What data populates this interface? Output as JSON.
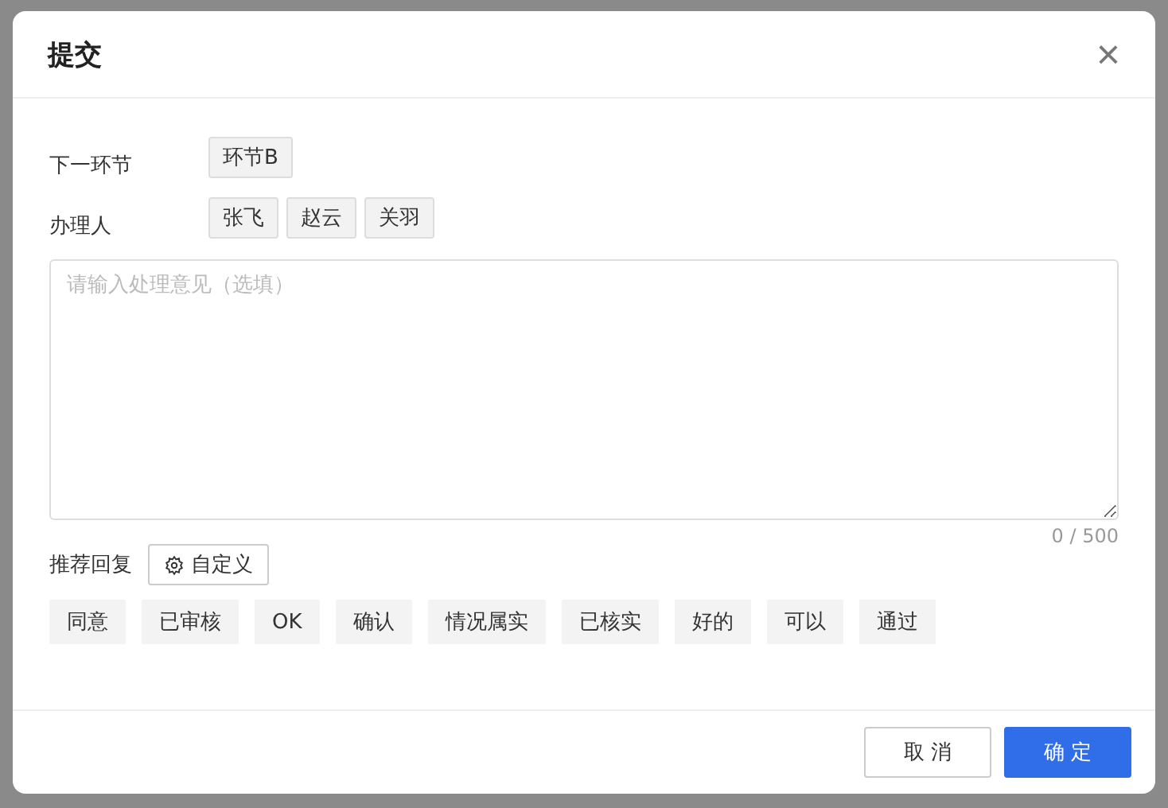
{
  "dialog": {
    "title": "提交",
    "close": "×"
  },
  "fields": [
    {
      "label": "下一环节",
      "tags": [
        "环节B"
      ]
    },
    {
      "label": "办理人",
      "tags": [
        "张飞",
        "赵云",
        "关羽"
      ]
    }
  ],
  "comment": {
    "placeholder": "请输入处理意见（选填）",
    "counter": "0 / 500"
  },
  "recommend": {
    "label": "推荐回复",
    "custom_button": "自定义",
    "replies": [
      "同意",
      "已审核",
      "OK",
      "确认",
      "情况属实",
      "已核实",
      "好的",
      "可以",
      "通过"
    ]
  },
  "buttons": [
    {
      "label": "取 消",
      "kind": "default"
    },
    {
      "label": "确 定",
      "kind": "primary"
    }
  ]
}
